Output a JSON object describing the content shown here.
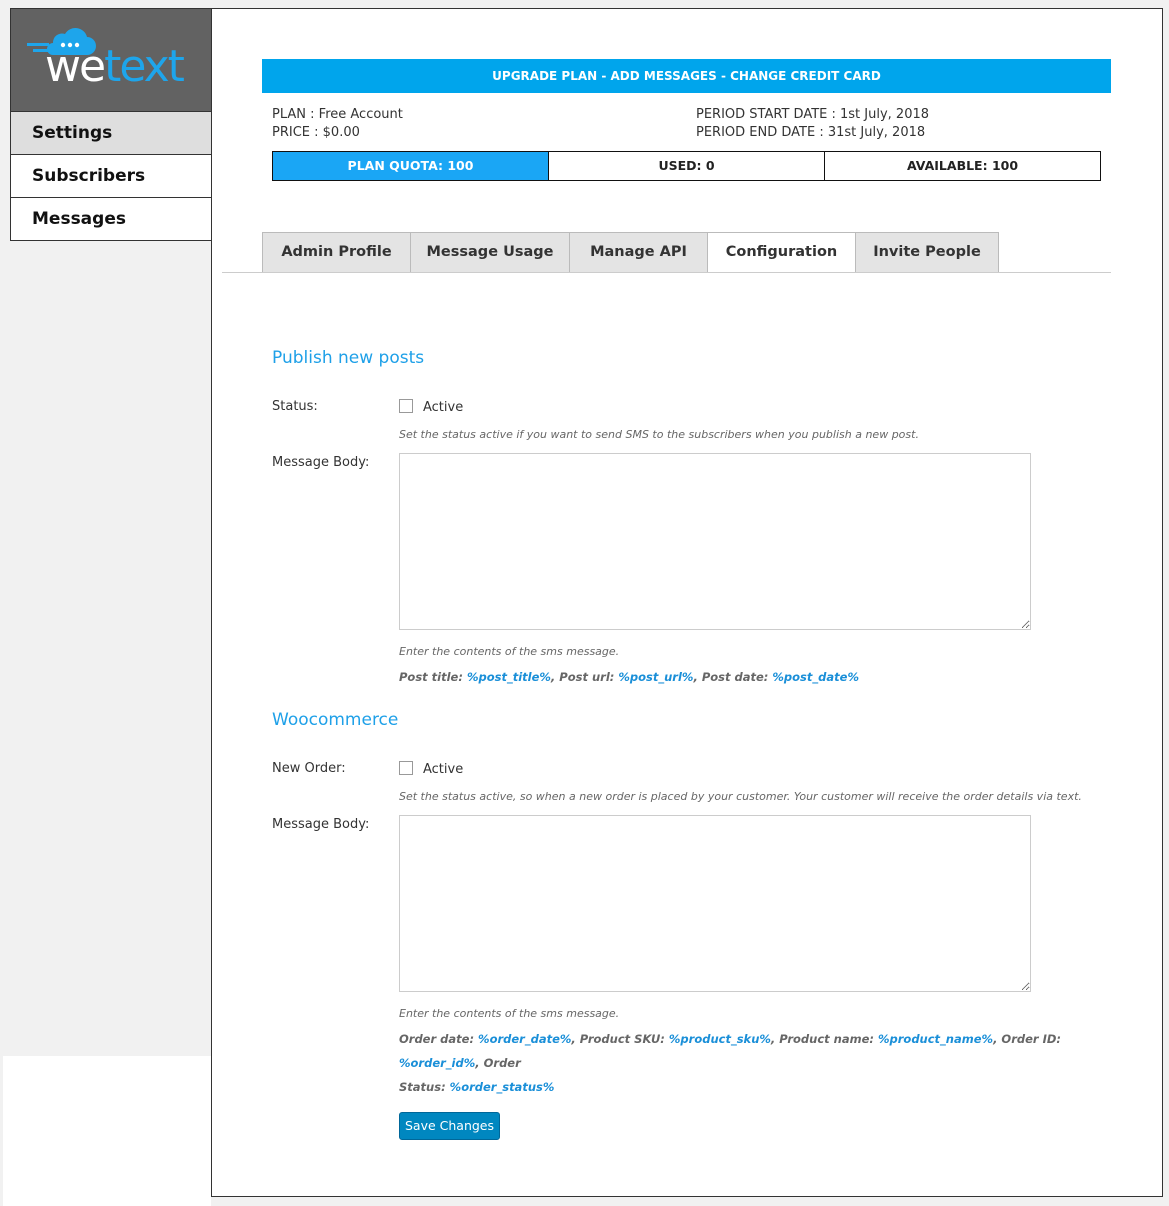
{
  "app": {
    "logo": {
      "we": "we",
      "text": "text"
    }
  },
  "colors": {
    "accent": "#00a5ec",
    "plan_quota_bg": "#1aa6f5",
    "sidebar_logo_bg": "#626262",
    "button": "#0087c0"
  },
  "sidebar": {
    "items": [
      {
        "label": "Settings",
        "active": true
      },
      {
        "label": "Subscribers",
        "active": false
      },
      {
        "label": "Messages",
        "active": false
      }
    ]
  },
  "banner": {
    "text": "UPGRADE PLAN - ADD MESSAGES - CHANGE CREDIT CARD"
  },
  "plan": {
    "plan_label": "PLAN :",
    "plan_value": "Free Account",
    "price_label": "PRICE :",
    "price_value": "$0.00",
    "start_label": "PERIOD START DATE :",
    "start_value": "1st July, 2018",
    "end_label": "PERIOD END DATE :",
    "end_value": "31st July, 2018"
  },
  "quota": {
    "plan_quota": "PLAN QUOTA: 100",
    "used": "USED: 0",
    "available": "AVAILABLE: 100"
  },
  "tabs": [
    {
      "label": "Admin Profile",
      "active": false
    },
    {
      "label": "Message Usage",
      "active": false
    },
    {
      "label": "Manage API",
      "active": false
    },
    {
      "label": "Configuration",
      "active": true
    },
    {
      "label": "Invite People",
      "active": false
    }
  ],
  "publish": {
    "title": "Publish new posts",
    "status_label": "Status:",
    "checkbox_label": "Active",
    "checked": false,
    "status_desc": "Set the status active if you want to send SMS to the subscribers when you publish a new post.",
    "body_label": "Message Body:",
    "body_value": "",
    "body_desc": "Enter the contents of the sms message.",
    "vars": {
      "post_title_label": "Post title: ",
      "post_title_token": "%post_title%",
      "post_url_label": ", Post url: ",
      "post_url_token": "%post_url%",
      "post_date_label": ", Post date: ",
      "post_date_token": "%post_date%"
    }
  },
  "woocommerce": {
    "title": "Woocommerce",
    "order_label": "New Order:",
    "checkbox_label": "Active",
    "checked": false,
    "order_desc": "Set the status active, so when a new order is placed by your customer. Your customer will receive the order details via text.",
    "body_label": "Message Body:",
    "body_value": "",
    "body_desc": "Enter the contents of the sms message.",
    "vars": {
      "order_date_label": "Order date: ",
      "order_date_token": "%order_date%",
      "sku_label": ", Product SKU: ",
      "sku_token": "%product_sku%",
      "name_label": ", Product name: ",
      "name_token": "%product_name%",
      "id_label": ", Order ID: ",
      "id_token": "%order_id%",
      "status_label_a": ", Order",
      "status_label_b": "Status: ",
      "status_token": "%order_status%"
    }
  },
  "save_button": {
    "label": "Save Changes"
  }
}
